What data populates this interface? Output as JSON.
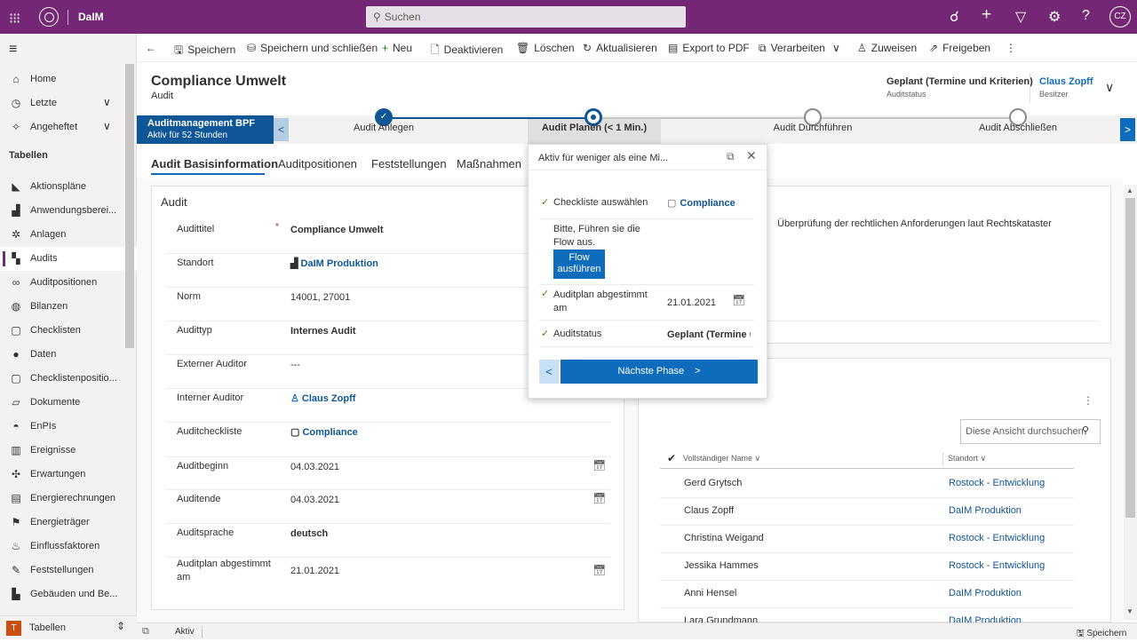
{
  "topbar": {
    "app_name": "DaIM",
    "search_placeholder": "Suchen",
    "user_initials": "CZ"
  },
  "sidebar": {
    "items": [
      {
        "label": "Home",
        "icon": "home-icon",
        "glyph": "⌂"
      },
      {
        "label": "Letzte",
        "icon": "clock-icon",
        "glyph": "◷",
        "chevron": "∨"
      },
      {
        "label": "Angeheftet",
        "icon": "pin-icon",
        "glyph": "✧",
        "chevron": "∨"
      }
    ],
    "section": "Tabellen",
    "tables": [
      {
        "label": "Aktionspläne",
        "icon": "action-plan-icon",
        "glyph": "◣"
      },
      {
        "label": "Anwendungsberei...",
        "icon": "chart-icon",
        "glyph": "▟"
      },
      {
        "label": "Anlagen",
        "icon": "plant-icon",
        "glyph": "✲"
      },
      {
        "label": "Audits",
        "icon": "audit-icon",
        "glyph": "▚"
      },
      {
        "label": "Auditpositionen",
        "icon": "link-icon",
        "glyph": "∞"
      },
      {
        "label": "Bilanzen",
        "icon": "globe-icon",
        "glyph": "◍"
      },
      {
        "label": "Checklisten",
        "icon": "checklist-icon",
        "glyph": "▢"
      },
      {
        "label": "Daten",
        "icon": "person-icon",
        "glyph": "●"
      },
      {
        "label": "Checklistenpositio...",
        "icon": "document-icon",
        "glyph": "▢"
      },
      {
        "label": "Dokumente",
        "icon": "folder-icon",
        "glyph": "▱"
      },
      {
        "label": "EnPIs",
        "icon": "gauge-icon",
        "glyph": "◓"
      },
      {
        "label": "Ereignisse",
        "icon": "building-icon",
        "glyph": "▥"
      },
      {
        "label": "Erwartungen",
        "icon": "network-icon",
        "glyph": "✣"
      },
      {
        "label": "Energierechnungen",
        "icon": "bill-icon",
        "glyph": "▤"
      },
      {
        "label": "Energieträger",
        "icon": "energy-icon",
        "glyph": "⚑"
      },
      {
        "label": "Einflussfaktoren",
        "icon": "factor-icon",
        "glyph": "♨"
      },
      {
        "label": "Feststellungen",
        "icon": "findings-icon",
        "glyph": "✎"
      },
      {
        "label": "Gebäuden und Be...",
        "icon": "factory-icon",
        "glyph": "▙"
      }
    ],
    "bottom_badge": "T",
    "bottom_label": "Tabellen"
  },
  "commands": {
    "back": "←",
    "save": "Speichern",
    "save_close": "Speichern und schließen",
    "new": "Neu",
    "deactivate": "Deaktivieren",
    "delete": "Löschen",
    "refresh": "Aktualisieren",
    "export": "Export to PDF",
    "process": "Verarbeiten",
    "assign": "Zuweisen",
    "share": "Freigeben",
    "more": "⋮"
  },
  "header": {
    "title": "Compliance Umwelt",
    "entity": "Audit",
    "status_value": "Geplant (Termine und Kriterien)",
    "status_label": "Auditstatus",
    "owner_value": "Claus Zopff",
    "owner_label": "Besitzer"
  },
  "bpf": {
    "name": "Auditmanagement BPF",
    "active_for": "Aktiv für 52 Stunden",
    "stages": [
      {
        "label": "Audit Anlegen",
        "state": "done"
      },
      {
        "label": "Audit Planen  (< 1 Min.)",
        "state": "active"
      },
      {
        "label": "Audit Durchführen",
        "state": "pending"
      },
      {
        "label": "Audit Abschließen",
        "state": "pending"
      }
    ]
  },
  "tabs": [
    "Audit Basisinformation",
    "Auditpositionen",
    "Feststellungen",
    "Maßnahmen"
  ],
  "form": {
    "section_title": "Audit",
    "fields": [
      {
        "label": "Audittitel",
        "value": "Compliance Umwelt",
        "style": "bold",
        "required": "*"
      },
      {
        "label": "Standort",
        "value": "DaIM Produktion",
        "style": "link"
      },
      {
        "label": "Norm",
        "value": "14001, 27001",
        "style": "plain"
      },
      {
        "label": "Audittyp",
        "value": "Internes Audit",
        "style": "bold"
      },
      {
        "label": "Externer Auditor",
        "value": "---",
        "style": "plain"
      },
      {
        "label": "Interner Auditor",
        "value": "Claus Zopff",
        "style": "link"
      },
      {
        "label": "Auditcheckliste",
        "value": "Compliance",
        "style": "link"
      },
      {
        "label": "Auditbeginn",
        "value": "04.03.2021",
        "style": "plain"
      },
      {
        "label": "Auditende",
        "value": "04.03.2021",
        "style": "plain"
      },
      {
        "label": "Auditsprache",
        "value": "deutsch",
        "style": "bold"
      },
      {
        "label": "Auditplan abgestimmt am",
        "value": "21.01.2021",
        "style": "plain"
      }
    ]
  },
  "right_panel": {
    "description": "Überprüfung der rechtlichen Anforderungen laut Rechtskataster",
    "search_placeholder": "Diese Ansicht durchsuchen",
    "col_name": "Vollständiger Name",
    "col_location": "Standort",
    "rows": [
      {
        "name": "Gerd Grytsch",
        "location": "Rostock - Entwicklung"
      },
      {
        "name": "Claus Zopff",
        "location": "DaIM Produktion"
      },
      {
        "name": "Christina Weigand",
        "location": "Rostock - Entwicklung"
      },
      {
        "name": "Jessika Hammes",
        "location": "Rostock - Entwicklung"
      },
      {
        "name": "Anni Hensel",
        "location": "DaIM Produktion"
      },
      {
        "name": "Lara Grundmann",
        "location": "DaIM Produktion"
      }
    ]
  },
  "flyout": {
    "header": "Aktiv für weniger als eine Mi...",
    "step1_label": "Checkliste auswählen",
    "step1_value": "Compliance",
    "flow_text": "Bitte, Führen sie die Flow aus.",
    "flow_button": "Flow ausführen",
    "step2_label": "Auditplan abgestimmt am",
    "step2_value": "21.01.2021",
    "step3_label": "Auditstatus",
    "step3_value": "Geplant (Termine und Kriterien)",
    "next_label": "Nächste Phase"
  },
  "statusbar": {
    "state": "Aktiv",
    "save": "Speichern"
  },
  "colors": {
    "brand": "#742774",
    "accent": "#0f6cbd",
    "bpf": "#0f5696"
  }
}
